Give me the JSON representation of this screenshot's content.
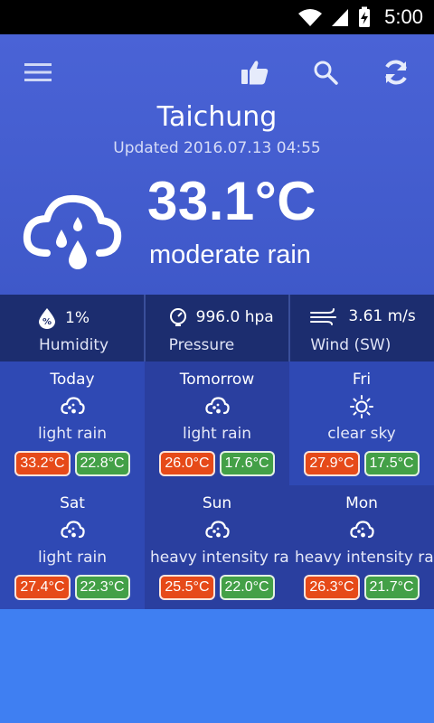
{
  "status_bar": {
    "time": "5:00"
  },
  "header": {
    "city": "Taichung",
    "updated": "Updated 2016.07.13 04:55"
  },
  "current": {
    "temperature": "33.1°C",
    "description": "moderate rain",
    "icon": "rain-cloud-icon"
  },
  "stats": [
    {
      "value": "1%",
      "label": "Humidity",
      "icon": "humidity-icon"
    },
    {
      "value": "996.0 hpa",
      "label": "Pressure",
      "icon": "pressure-gauge-icon"
    },
    {
      "value": "3.61 m/s",
      "label": "Wind (SW)",
      "icon": "wind-icon"
    }
  ],
  "forecast": [
    {
      "day": "Today",
      "condition": "light rain",
      "high": "33.2°C",
      "low": "22.8°C",
      "icon": "rain-cloud-icon"
    },
    {
      "day": "Tomorrow",
      "condition": "light rain",
      "high": "26.0°C",
      "low": "17.6°C",
      "icon": "rain-cloud-icon"
    },
    {
      "day": "Fri",
      "condition": "clear sky",
      "high": "27.9°C",
      "low": "17.5°C",
      "icon": "sun-icon"
    },
    {
      "day": "Sat",
      "condition": "light rain",
      "high": "27.4°C",
      "low": "22.3°C",
      "icon": "rain-cloud-icon"
    },
    {
      "day": "Sun",
      "condition": "heavy intensity rain",
      "high": "25.5°C",
      "low": "22.0°C",
      "icon": "rain-cloud-icon"
    },
    {
      "day": "Mon",
      "condition": "heavy intensity rain",
      "high": "26.3°C",
      "low": "21.7°C",
      "icon": "rain-cloud-icon"
    }
  ],
  "colors": {
    "high_chip": "#e64a19",
    "low_chip": "#43a047",
    "stats_bar": "#1c2d6f",
    "page_background": "#3f7ff2"
  }
}
